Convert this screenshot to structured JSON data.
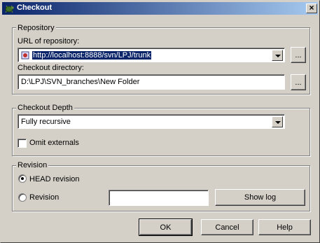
{
  "window": {
    "title": "Checkout",
    "close_glyph": "×",
    "app_icon": "tortoise-icon"
  },
  "repository": {
    "legend": "Repository",
    "url_label": "URL of repository:",
    "url_value": "http://localhost:8888/svn/LPJ/trunk",
    "url_icon": "repository-url-icon",
    "browse_label": "...",
    "dir_label": "Checkout directory:",
    "dir_value": "D:\\LPJ\\SVN_branches\\New Folder",
    "dir_browse_label": "..."
  },
  "depth": {
    "legend": "Checkout Depth",
    "selected": "Fully recursive",
    "omit_externals_label": "Omit externals",
    "omit_externals_checked": false
  },
  "revision": {
    "legend": "Revision",
    "head_label": "HEAD revision",
    "head_checked": true,
    "revision_label": "Revision",
    "revision_checked": false,
    "revision_value": "",
    "show_log_label": "Show log"
  },
  "buttons": {
    "ok": "OK",
    "cancel": "Cancel",
    "help": "Help"
  }
}
